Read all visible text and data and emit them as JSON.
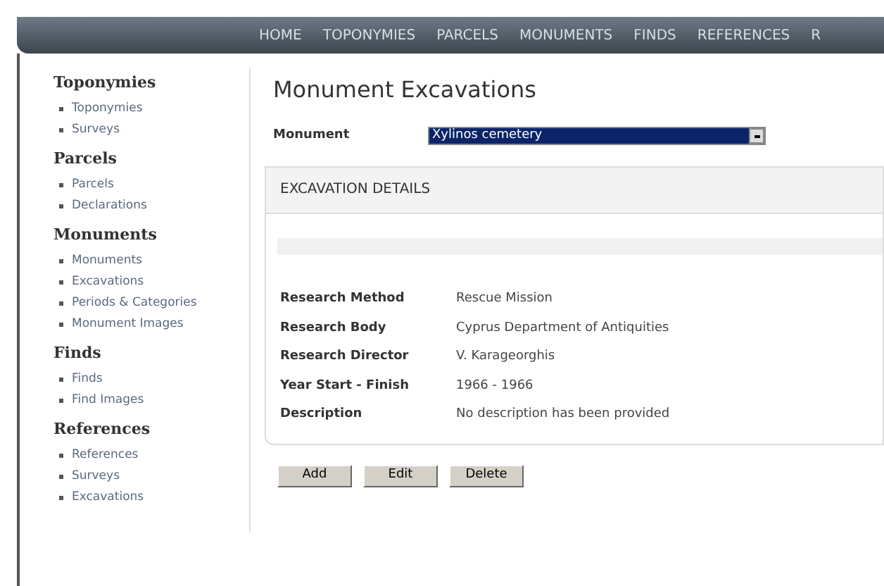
{
  "nav": [
    "HOME",
    "TOPONYMIES",
    "PARCELS",
    "MONUMENTS",
    "FINDS",
    "REFERENCES",
    "R"
  ],
  "sidebar": [
    {
      "heading": "Toponymies",
      "items": [
        "Toponymies",
        "Surveys"
      ]
    },
    {
      "heading": "Parcels",
      "items": [
        "Parcels",
        "Declarations"
      ]
    },
    {
      "heading": "Monuments",
      "items": [
        "Monuments",
        "Excavations",
        "Periods & Categories",
        "Monument Images"
      ]
    },
    {
      "heading": "Finds",
      "items": [
        "Finds",
        "Find Images"
      ]
    },
    {
      "heading": "References",
      "items": [
        "References",
        "Surveys",
        "Excavations"
      ]
    }
  ],
  "page_title": "Monument Excavations",
  "monument": {
    "label": "Monument",
    "value": "Xylinos cemetery"
  },
  "panel": {
    "title": "EXCAVATION DETAILS",
    "rows": [
      {
        "label": "Research Method",
        "value": "Rescue Mission"
      },
      {
        "label": "Research Body",
        "value": "Cyprus Department of Antiquities"
      },
      {
        "label": "Research Director",
        "value": "V. Karageorghis"
      },
      {
        "label": "Year Start - Finish",
        "value": "1966 - 1966"
      },
      {
        "label": "Description",
        "value": "No description has been provided"
      }
    ]
  },
  "buttons": [
    "Add",
    "Edit",
    "Delete"
  ]
}
